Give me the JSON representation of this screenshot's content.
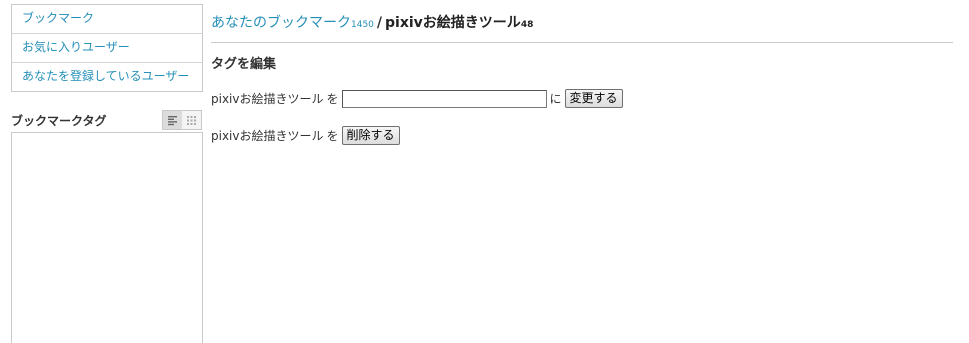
{
  "sidebar": {
    "nav": [
      {
        "label": "ブックマーク"
      },
      {
        "label": "お気に入りユーザー"
      },
      {
        "label": "あなたを登録しているユーザー"
      }
    ],
    "tags_title": "ブックマークタグ",
    "view_toggle": {
      "list_icon": "list-view-icon",
      "grid_icon": "grid-view-icon",
      "active": "list"
    }
  },
  "breadcrumb": {
    "parent": "あなたのブックマーク",
    "parent_count": "1450",
    "separator": "/",
    "current": "pixivお絵描きツール",
    "current_count": "48"
  },
  "section": {
    "title": "タグを編集"
  },
  "rename_form": {
    "tag_label": "pixivお絵描きツール",
    "particle_wo": "を",
    "input_value": "",
    "particle_ni": "に",
    "submit_label": "変更する"
  },
  "delete_form": {
    "tag_label": "pixivお絵描きツール",
    "particle_wo": "を",
    "submit_label": "削除する"
  },
  "colors": {
    "link": "#258fb8",
    "border": "#c9c9c9"
  }
}
